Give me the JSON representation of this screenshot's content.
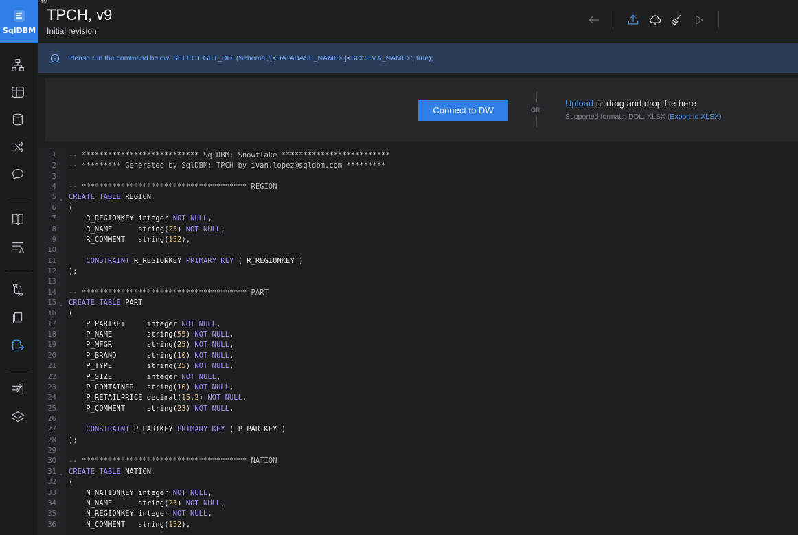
{
  "app": {
    "brand": "SqlDBM",
    "trademark": "TM",
    "title": "TPCH, v9",
    "subtitle": "Initial revision"
  },
  "toolbar": {
    "icons": [
      "arrow-left-icon",
      "upload-icon",
      "cloud-icon",
      "broom-icon",
      "play-icon"
    ]
  },
  "rail": {
    "icons": [
      "hierarchy-icon",
      "table-grid-icon",
      "database-icon",
      "shuffle-icon",
      "comment-icon",
      "book-icon",
      "text-format-icon",
      "compare-icon",
      "notebook-icon",
      "database-export-icon",
      "import-arrows-icon",
      "layers-icon"
    ]
  },
  "banner": {
    "message": "Please run the command below: SELECT GET_DDL('schema','[<DATABASE_NAME>.]<SCHEMA_NAME>', true);"
  },
  "connect": {
    "button": "Connect to DW",
    "or": "OR",
    "upload_link": "Upload",
    "upload_rest": " or drag and drop file here",
    "formats_prefix": "Supported formats: DDL, XLSX (",
    "export_link": "Export to XLSX",
    "formats_suffix": ")"
  },
  "code": {
    "lines": [
      "-- *************************** SqlDBM: Snowflake *************************",
      "-- ********* Generated by SqlDBM: TPCH by ivan.lopez@sqldbm.com *********",
      "",
      "-- ************************************** REGION",
      "CREATE TABLE REGION",
      "(",
      "    R_REGIONKEY integer NOT NULL,",
      "    R_NAME      string(25) NOT NULL,",
      "    R_COMMENT   string(152),",
      "",
      "    CONSTRAINT R_REGIONKEY PRIMARY KEY ( R_REGIONKEY )",
      ");",
      "",
      "-- ************************************** PART",
      "CREATE TABLE PART",
      "(",
      "    P_PARTKEY     integer NOT NULL,",
      "    P_NAME        string(55) NOT NULL,",
      "    P_MFGR        string(25) NOT NULL,",
      "    P_BRAND       string(10) NOT NULL,",
      "    P_TYPE        string(25) NOT NULL,",
      "    P_SIZE        integer NOT NULL,",
      "    P_CONTAINER   string(10) NOT NULL,",
      "    P_RETAILPRICE decimal(15,2) NOT NULL,",
      "    P_COMMENT     string(23) NOT NULL,",
      "",
      "    CONSTRAINT P_PARTKEY PRIMARY KEY ( P_PARTKEY )",
      ");",
      "",
      "-- ************************************** NATION",
      "CREATE TABLE NATION",
      "(",
      "    N_NATIONKEY integer NOT NULL,",
      "    N_NAME      string(25) NOT NULL,",
      "    N_REGIONKEY integer NOT NULL,",
      "    N_COMMENT   string(152),"
    ],
    "fold_lines": [
      5,
      15,
      31
    ]
  },
  "colors": {
    "accent": "#2f7fe6",
    "keyword": "#9d8cf0",
    "number": "#e6c07b",
    "banner_bg": "#2b3c57",
    "banner_text": "#6fa8ff"
  }
}
